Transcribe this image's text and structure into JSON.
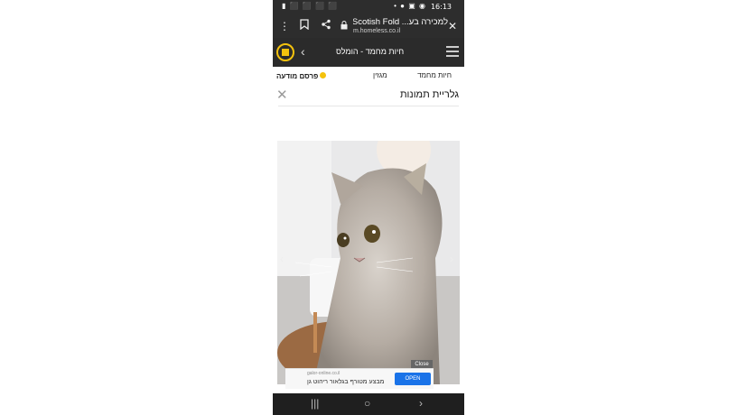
{
  "status": {
    "time": "16:13",
    "left_icons": "▮ ⬛ ⬛ ⬛ ⬛",
    "right_icons": "• ● ▣ ◉"
  },
  "browser": {
    "title": "למכירה בע... Scotish Fold",
    "url": "m.homeless.co.il",
    "icons": [
      "more-icon",
      "bookmark-icon",
      "share-icon",
      "lock-icon",
      "close-icon"
    ]
  },
  "site": {
    "title": "חיות מחמד - הומלס"
  },
  "nav": {
    "publish": "פרסם מודעה",
    "magazine": "מגזין",
    "pets": "חיות מחמד"
  },
  "gallery": {
    "title": "גלריית תמונות",
    "close": "✕"
  },
  "ad": {
    "domain": "galor-online.co.il",
    "text": "מבצע מטורף בגלאור ריהוט גן",
    "open": "OPEN",
    "close": "Close"
  },
  "android_nav": {
    "recent": "|||",
    "home": "○",
    "back": "›"
  }
}
